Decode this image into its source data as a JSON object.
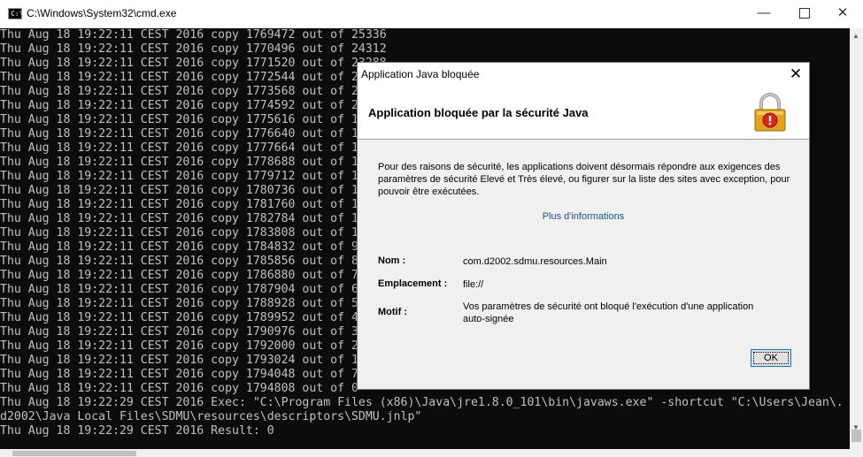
{
  "window": {
    "title": "C:\\Windows\\System32\\cmd.exe",
    "icon_label": "C:\\",
    "minimize_glyph": "—",
    "close_glyph": "✕"
  },
  "console": {
    "lines": [
      "Thu Aug 18 19:22:11 CEST 2016 copy 1769472 out of 25336",
      "Thu Aug 18 19:22:11 CEST 2016 copy 1770496 out of 24312",
      "Thu Aug 18 19:22:11 CEST 2016 copy 1771520 out of 23288",
      "Thu Aug 18 19:22:11 CEST 2016 copy 1772544 out of 22264",
      "Thu Aug 18 19:22:11 CEST 2016 copy 1773568 out of 21240",
      "Thu Aug 18 19:22:11 CEST 2016 copy 1774592 out of 20216",
      "Thu Aug 18 19:22:11 CEST 2016 copy 1775616 out of 19192",
      "Thu Aug 18 19:22:11 CEST 2016 copy 1776640 out of 18168",
      "Thu Aug 18 19:22:11 CEST 2016 copy 1777664 out of 17144",
      "Thu Aug 18 19:22:11 CEST 2016 copy 1778688 out of 16120",
      "Thu Aug 18 19:22:11 CEST 2016 copy 1779712 out of 15096",
      "Thu Aug 18 19:22:11 CEST 2016 copy 1780736 out of 14072",
      "Thu Aug 18 19:22:11 CEST 2016 copy 1781760 out of 13048",
      "Thu Aug 18 19:22:11 CEST 2016 copy 1782784 out of 12024",
      "Thu Aug 18 19:22:11 CEST 2016 copy 1783808 out of 11000",
      "Thu Aug 18 19:22:11 CEST 2016 copy 1784832 out of 9976",
      "Thu Aug 18 19:22:11 CEST 2016 copy 1785856 out of 8952",
      "Thu Aug 18 19:22:11 CEST 2016 copy 1786880 out of 7928",
      "Thu Aug 18 19:22:11 CEST 2016 copy 1787904 out of 6904",
      "Thu Aug 18 19:22:11 CEST 2016 copy 1788928 out of 5880",
      "Thu Aug 18 19:22:11 CEST 2016 copy 1789952 out of 4856",
      "Thu Aug 18 19:22:11 CEST 2016 copy 1790976 out of 3832",
      "Thu Aug 18 19:22:11 CEST 2016 copy 1792000 out of 2808",
      "Thu Aug 18 19:22:11 CEST 2016 copy 1793024 out of 1784",
      "Thu Aug 18 19:22:11 CEST 2016 copy 1794048 out of 760",
      "Thu Aug 18 19:22:11 CEST 2016 copy 1794808 out of 0",
      "Thu Aug 18 19:22:29 CEST 2016 Exec: \"C:\\Program Files (x86)\\Java\\jre1.8.0_101\\bin\\javaws.exe\" -shortcut \"C:\\Users\\Jean\\.",
      "d2002\\Java Local Files\\SDMU\\resources\\descriptors\\SDMU.jnlp\"",
      "Thu Aug 18 19:22:29 CEST 2016 Result: 0"
    ]
  },
  "dialog": {
    "title": "Application Java bloquée",
    "close_glyph": "✕",
    "heading": "Application bloquée par la sécurité Java",
    "message": "Pour des raisons de sécurité, les applications doivent désormais répondre aux exigences des paramètres de sécurité Elevé et Très élevé, ou figurer sur la liste des sites avec exception, pour pouvoir être exécutées.",
    "more_info_link": "Plus d'informations",
    "fields": {
      "name_label": "Nom :",
      "name_value": "com.d2002.sdmu.resources.Main",
      "location_label": "Emplacement :",
      "location_value": "file://",
      "reason_label": "Motif :",
      "reason_value": "Vos paramètres de sécurité ont bloqué l'exécution d'une application auto-signée"
    },
    "ok_label": "OK"
  },
  "colors": {
    "console_bg": "#0c0c0c",
    "console_text": "#c0c0c0",
    "dialog_bg": "#f0f0f0",
    "link": "#1a4f8c",
    "ok_border": "#0078d7"
  }
}
